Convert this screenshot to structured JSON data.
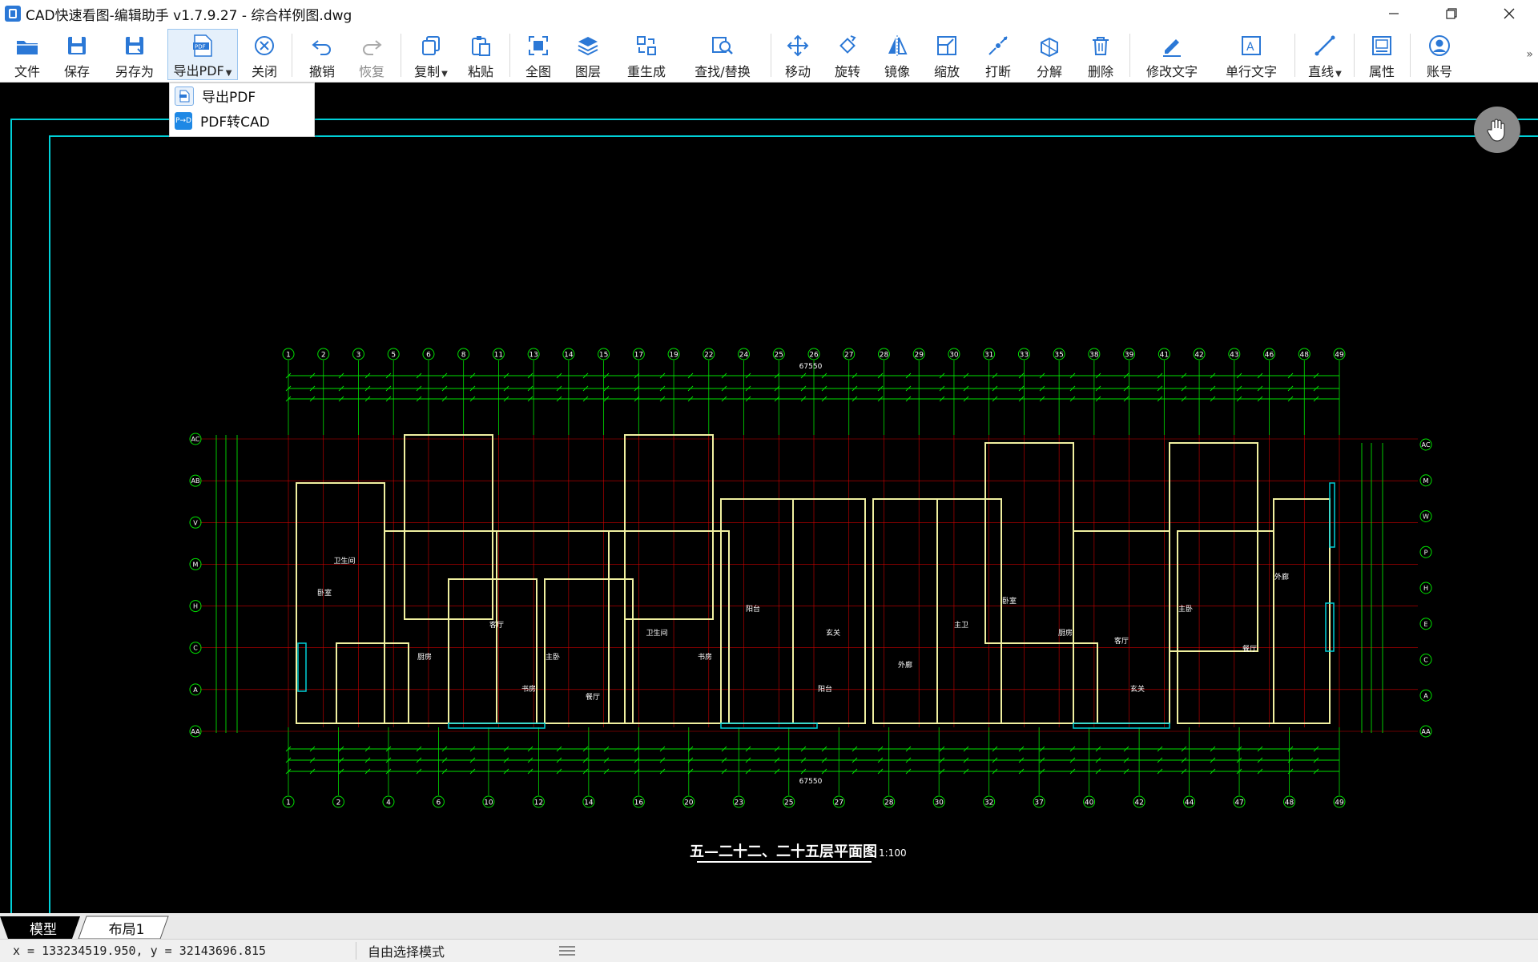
{
  "window": {
    "title": "CAD快速看图-编辑助手 v1.7.9.27 - 综合样例图.dwg"
  },
  "toolbar": {
    "items": [
      {
        "label": "文件"
      },
      {
        "label": "保存"
      },
      {
        "label": "另存为"
      },
      {
        "label": "导出PDF"
      },
      {
        "label": "关闭"
      },
      {
        "label": "撤销"
      },
      {
        "label": "恢复"
      },
      {
        "label": "复制"
      },
      {
        "label": "粘贴"
      },
      {
        "label": "全图"
      },
      {
        "label": "图层"
      },
      {
        "label": "重生成"
      },
      {
        "label": "查找/替换"
      },
      {
        "label": "移动"
      },
      {
        "label": "旋转"
      },
      {
        "label": "镜像"
      },
      {
        "label": "缩放"
      },
      {
        "label": "打断"
      },
      {
        "label": "分解"
      },
      {
        "label": "删除"
      },
      {
        "label": "修改文字"
      },
      {
        "label": "单行文字"
      },
      {
        "label": "直线"
      },
      {
        "label": "属性"
      },
      {
        "label": "账号"
      }
    ]
  },
  "dropdown": {
    "items": [
      {
        "label": "导出PDF",
        "icon": "pdf-icon"
      },
      {
        "label": "PDF转CAD",
        "icon": "pdf-to-cad-icon"
      }
    ]
  },
  "drawing": {
    "caption": "五—二十二、二十五层平面图",
    "scale": "1:100",
    "total_dimension_top": "67550",
    "total_dimension_bottom": "67550",
    "grid_top": [
      "1",
      "2",
      "3",
      "5",
      "6",
      "8",
      "11",
      "13",
      "14",
      "15",
      "17",
      "19",
      "22",
      "24",
      "25",
      "26",
      "27",
      "28",
      "29",
      "30",
      "31",
      "33",
      "35",
      "38",
      "39",
      "41",
      "42",
      "43",
      "46",
      "48",
      "49"
    ],
    "grid_bottom": [
      "1",
      "2",
      "4",
      "6",
      "10",
      "12",
      "14",
      "16",
      "20",
      "23",
      "25",
      "27",
      "28",
      "30",
      "32",
      "37",
      "40",
      "42",
      "44",
      "47",
      "48",
      "49"
    ],
    "grid_left": [
      "AC",
      "AB",
      "V",
      "M",
      "H",
      "C",
      "A",
      "AA"
    ],
    "grid_right": [
      "AC",
      "M",
      "W",
      "P",
      "H",
      "E",
      "C",
      "A",
      "AA"
    ],
    "room_labels": [
      "卧室",
      "厨房",
      "客厅",
      "主卧",
      "餐厅",
      "卫生间",
      "书房",
      "阳台",
      "玄关",
      "外廊",
      "主卫"
    ]
  },
  "colors": {
    "canvas_bg": "#000000",
    "frame": "#00d0d8",
    "dimensions": "#00e000",
    "axis_lines": "#d00000",
    "walls": "#f0f0a0",
    "text": "#ffffff",
    "accent": "#2b78d6"
  },
  "tabs": {
    "model": "模型",
    "layout": "布局1"
  },
  "status": {
    "coords": "x = 133234519.950, y = 32143696.815",
    "mode": "自由选择模式"
  }
}
